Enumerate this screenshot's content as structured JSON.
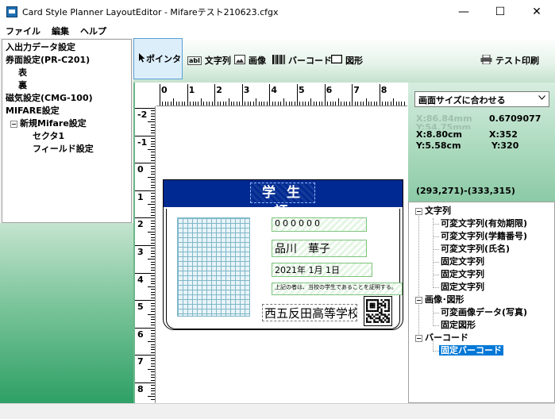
{
  "window": {
    "title": "Card Style Planner LayoutEditor - Mifareテスト210623.cfgx",
    "icon": "card-icon",
    "minimize": "—",
    "maximize": "☐",
    "close": "✕"
  },
  "menu": {
    "file": "ファイル",
    "edit": "編集",
    "help": "ヘルプ"
  },
  "left_tree": {
    "items": [
      "入出力データ設定",
      "券面設定(PR-C201)",
      "表",
      "裏",
      "磁気設定(CMG-100)",
      "MIFARE設定",
      "新規Mifare設定",
      "セクタ1",
      "フィールド設定"
    ]
  },
  "toolbar": {
    "pointer": "ポインタ",
    "text": "文字列",
    "image": "画像",
    "barcode": "バーコード",
    "shape": "図形",
    "test_print": "テスト印刷",
    "text_icon": "abl"
  },
  "ruler": {
    "top": [
      "0",
      "1",
      "2",
      "3",
      "4",
      "5",
      "6",
      "7",
      "8",
      "9"
    ],
    "left": [
      "-2",
      "-1",
      "0",
      "1",
      "2",
      "3",
      "4",
      "5",
      "6",
      "7",
      "8"
    ]
  },
  "card": {
    "title": "学 生 証",
    "number": "000000",
    "name": "品川　華子",
    "date": "2021年 1月 1日",
    "notice": "上記の者は、当校の学生であることを証明する。",
    "school": "西五反田高等学校"
  },
  "right_panel": {
    "zoom": "画面サイズに合わせる",
    "x_mm": "X:86.84mm",
    "y_mm": "Y:54.75mm",
    "scale": "0.6709077",
    "x_cm": "X:8.80cm",
    "y_cm": "Y:5.58cm",
    "x_px": "X:352",
    "y_px": "Y:320",
    "selection": "(293,271)-(333,315)"
  },
  "right_tree": {
    "text_group": "文字列",
    "text_items": [
      "可変文字列(有効期限)",
      "可変文字列(学籍番号)",
      "可変文字列(氏名)",
      "固定文字列",
      "固定文字列",
      "固定文字列"
    ],
    "image_group": "画像･図形",
    "image_items": [
      "可変画像データ(写真)",
      "固定図形"
    ],
    "barcode_group": "バーコード",
    "barcode_items": [
      "固定バーコード"
    ],
    "expander": "−"
  }
}
